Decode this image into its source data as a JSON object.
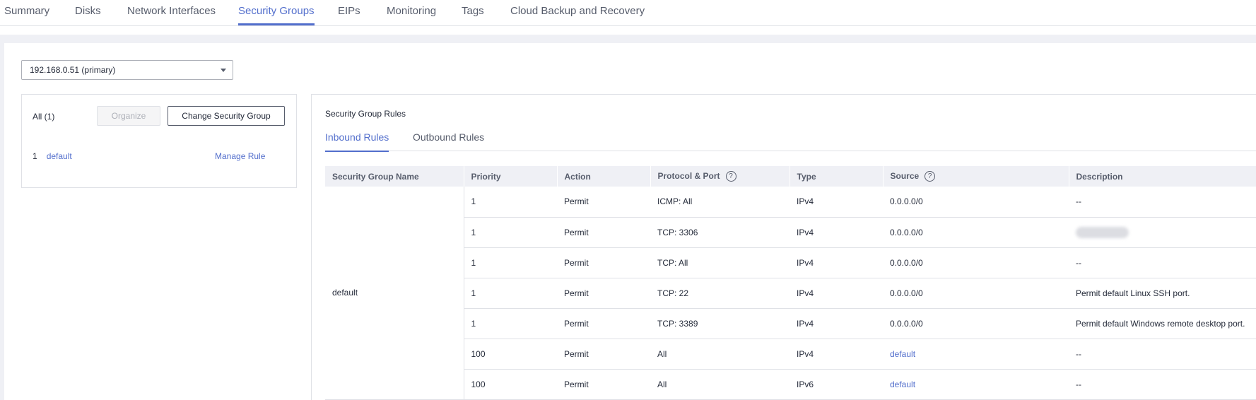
{
  "top_tabs": [
    {
      "label": "Summary",
      "active": false
    },
    {
      "label": "Disks",
      "active": false
    },
    {
      "label": "Network Interfaces",
      "active": false
    },
    {
      "label": "Security Groups",
      "active": true
    },
    {
      "label": "EIPs",
      "active": false
    },
    {
      "label": "Monitoring",
      "active": false
    },
    {
      "label": "Tags",
      "active": false
    },
    {
      "label": "Cloud Backup and Recovery",
      "active": false
    }
  ],
  "ip_select": {
    "value": "192.168.0.51 (primary)"
  },
  "left_panel": {
    "all_label": "All (1)",
    "organize_button": "Organize",
    "change_button": "Change Security Group",
    "group_row": {
      "index": "1",
      "name": "default",
      "manage_link": "Manage Rule"
    }
  },
  "right_panel": {
    "title": "Security Group Rules",
    "tabs": [
      {
        "label": "Inbound Rules",
        "active": true
      },
      {
        "label": "Outbound Rules",
        "active": false
      }
    ]
  },
  "table": {
    "columns": [
      "Security Group Name",
      "Priority",
      "Action",
      "Protocol & Port",
      "Type",
      "Source",
      "Description"
    ],
    "help_mark": "?",
    "group_name": "default",
    "rows": [
      {
        "priority": "1",
        "action": "Permit",
        "protocol": "ICMP: All",
        "type": "IPv4",
        "source": "0.0.0.0/0",
        "source_link": false,
        "description": "--"
      },
      {
        "priority": "1",
        "action": "Permit",
        "protocol": "TCP: 3306",
        "type": "IPv4",
        "source": "0.0.0.0/0",
        "source_link": false,
        "description": "",
        "description_blurred": true
      },
      {
        "priority": "1",
        "action": "Permit",
        "protocol": "TCP: All",
        "type": "IPv4",
        "source": "0.0.0.0/0",
        "source_link": false,
        "description": "--"
      },
      {
        "priority": "1",
        "action": "Permit",
        "protocol": "TCP: 22",
        "type": "IPv4",
        "source": "0.0.0.0/0",
        "source_link": false,
        "description": "Permit default Linux SSH port."
      },
      {
        "priority": "1",
        "action": "Permit",
        "protocol": "TCP: 3389",
        "type": "IPv4",
        "source": "0.0.0.0/0",
        "source_link": false,
        "description": "Permit default Windows remote desktop port."
      },
      {
        "priority": "100",
        "action": "Permit",
        "protocol": "All",
        "type": "IPv4",
        "source": "default",
        "source_link": true,
        "description": "--"
      },
      {
        "priority": "100",
        "action": "Permit",
        "protocol": "All",
        "type": "IPv6",
        "source": "default",
        "source_link": true,
        "description": "--"
      }
    ]
  },
  "colors": {
    "accent": "#526ecc",
    "text": "#252b3a",
    "muted": "#575d6c",
    "header_bg": "#eff0f5",
    "border": "#dfe1e6"
  }
}
